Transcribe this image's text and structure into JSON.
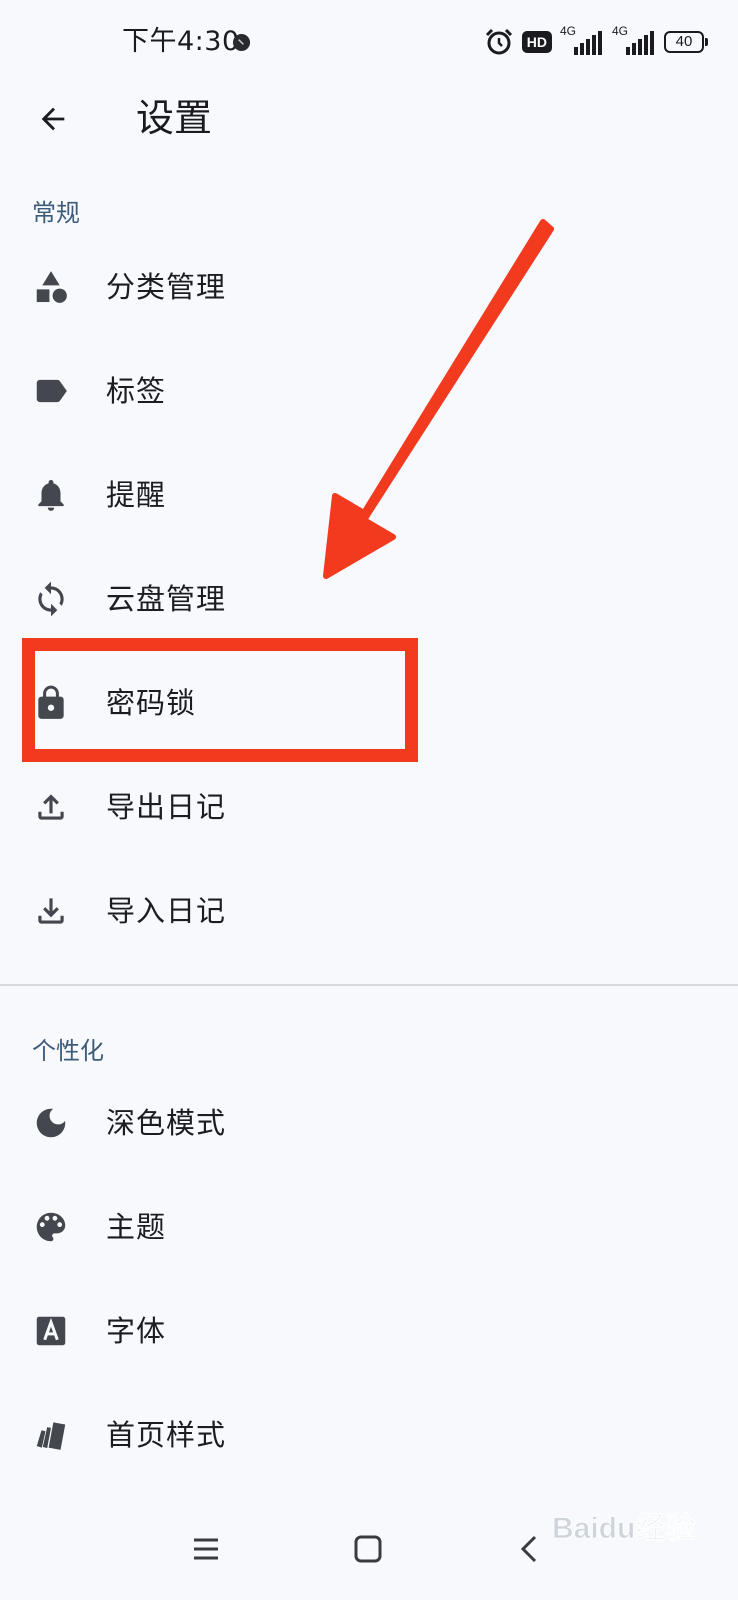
{
  "status_bar": {
    "time": "下午4:30",
    "hd_label": "HD",
    "net_1": "4G",
    "net_2": "4G",
    "battery": "40"
  },
  "app_bar": {
    "title": "设置"
  },
  "sections": {
    "general": {
      "header": "常规",
      "items": [
        {
          "label": "分类管理",
          "icon": "category-icon"
        },
        {
          "label": "标签",
          "icon": "label-icon"
        },
        {
          "label": "提醒",
          "icon": "bell-icon"
        },
        {
          "label": "云盘管理",
          "icon": "sync-icon"
        },
        {
          "label": "密码锁",
          "icon": "lock-icon"
        },
        {
          "label": "导出日记",
          "icon": "upload-icon"
        },
        {
          "label": "导入日记",
          "icon": "download-icon"
        }
      ]
    },
    "personalization": {
      "header": "个性化",
      "items": [
        {
          "label": "深色模式",
          "icon": "moon-icon"
        },
        {
          "label": "主题",
          "icon": "palette-icon"
        },
        {
          "label": "字体",
          "icon": "font-icon"
        },
        {
          "label": "首页样式",
          "icon": "cards-icon"
        }
      ]
    }
  },
  "colors": {
    "background": "#f7f9fd",
    "section_header": "#3e5c7a",
    "icon": "#44474e",
    "annotation": "#f13a1e"
  },
  "watermark": {
    "text": "Baidu经验"
  }
}
